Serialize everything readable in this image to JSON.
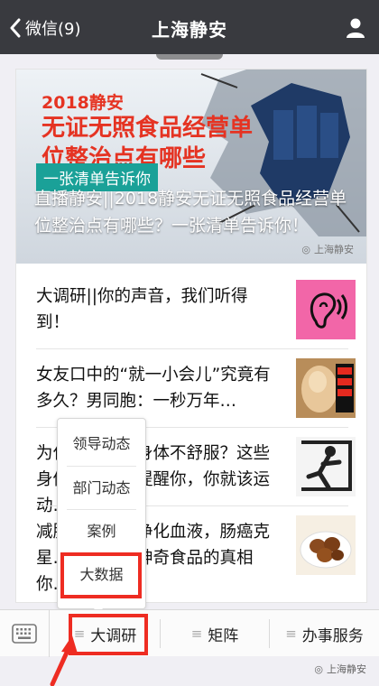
{
  "header": {
    "back_label": "微信(9)",
    "title": "上海静安"
  },
  "hero": {
    "year_label": "2018静安",
    "headline": "无证无照食品经营单位整治点有哪些",
    "tag": "一张清单告诉你",
    "caption": "直播静安||2018静安无证无照食品经营单位整治点有哪些？一张清单告诉你！",
    "watermark": "上海静安"
  },
  "articles": [
    {
      "title": "大调研||你的声音，我们听得到！",
      "thumb_icon": "ear-icon"
    },
    {
      "title": "女友口中的“就一小会儿”究竟有多久？男同胞：一秒万年…",
      "thumb_icon": "alpaca-photo"
    },
    {
      "title": "为什么运动后身体不舒服？这些身体信号是在提醒你，你就该运动…",
      "thumb_icon": "exercise-silhouette"
    },
    {
      "title": "减肥、刮油、净化血液，肠癌克星…揭秘这些神奇食品的真相你…",
      "thumb_icon": "food-photo"
    }
  ],
  "popup_menu": {
    "items": [
      "领导动态",
      "部门动态",
      "案例",
      "大数据"
    ]
  },
  "bottom_menu": {
    "tabs": [
      "大调研",
      "矩阵",
      "办事服务"
    ]
  },
  "footer_watermark": "上海静安",
  "colors": {
    "topbar": "#393a3f",
    "highlight": "#ee2c22",
    "hero_red": "#e53322",
    "hero_teal": "#1aa198"
  }
}
